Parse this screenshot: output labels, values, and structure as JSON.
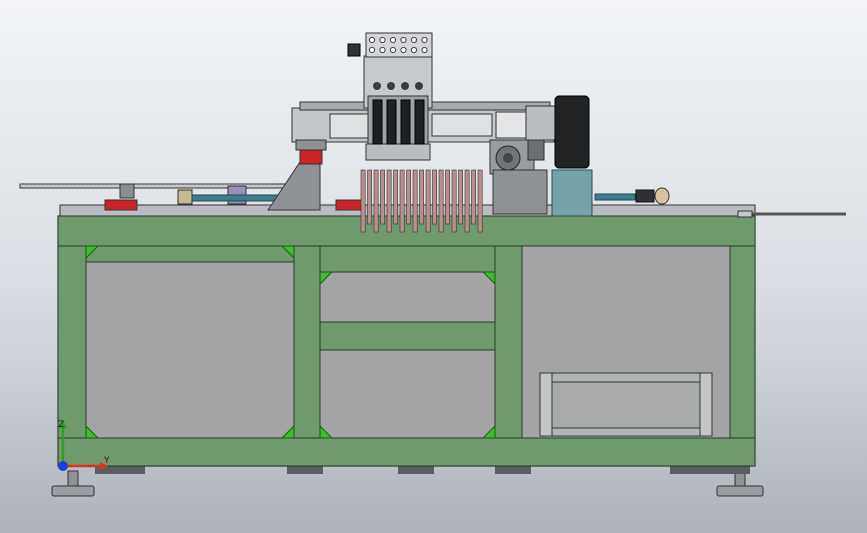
{
  "view": {
    "background_top": "#f2f4f6",
    "background_bottom": "#aeb3bb"
  },
  "colors": {
    "frame_green": "#6f9a6e",
    "frame_edge": "#2c3a2c",
    "panel_gray": "#a4a4a6",
    "metal_gray": "#b9bcc0",
    "dark_metal": "#3c3f42",
    "red_part": "#c8242a",
    "teal_part": "#3f7d8d",
    "motor_box": "#76a3aa",
    "gusset_green": "#3bbf2a"
  },
  "triad": {
    "y_label": "Y",
    "z_label": "Z",
    "y_axis_color": "#e03020",
    "z_axis_color": "#28a028",
    "x_axis_color": "#2040d0"
  },
  "icons": {
    "triad": "coordinate-triad-icon",
    "top_box": "control-box-icon"
  }
}
